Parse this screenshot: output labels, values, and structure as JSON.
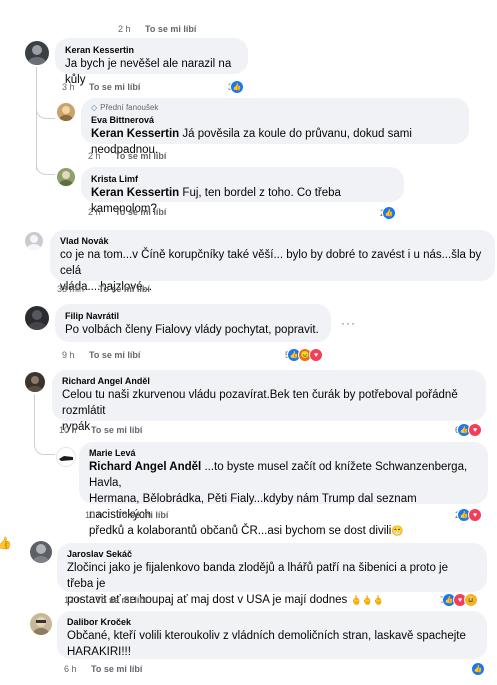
{
  "like_label": "To se mi líbí",
  "top": {
    "time": "2 h"
  },
  "comments": [
    {
      "author": "Keran Kessertin",
      "text": "Ja bych je nevěšel ale narazil na kůly",
      "time": "3 h",
      "reactions": "3",
      "replies": [
        {
          "badge": "Přední fanoušek",
          "author": "Eva Bittnerová",
          "mention": "Keran Kessertin",
          "text": " Já pověsila za koule do průvanu, dokud sami neodpadnou.",
          "time": "2 h"
        },
        {
          "author": "Krista Limf",
          "mention": "Keran Kessertin",
          "text": " Fuj, ten bordel z toho. Co třeba kamenolom?",
          "time": "2 h",
          "reactions": "2"
        }
      ]
    },
    {
      "author": "Vlad Novák",
      "text_lines": [
        "co je na tom...v Číně korupčníky také věší... bylo by dobré to zavést i u nás...šla by celá",
        "vláda....hajzlové..."
      ],
      "time": "33 min"
    },
    {
      "author": "Filip Navrátil",
      "text": "Po volbách členy Fialovy vlády pochytat, popravit.",
      "time": "9 h",
      "reactions": "5",
      "more": "···"
    },
    {
      "author": "Richard Angel Anděl",
      "text_lines": [
        "Celou tu naši zkurvenou vládu pozavírat.Bek ten čurák by potřeboval pořádně rozmlátit",
        "rypák"
      ],
      "time": "10 h",
      "reactions": "6",
      "replies": [
        {
          "author": "Marie Levá",
          "mention": "Richard Angel Anděl",
          "text_lines": [
            " ...to byste musel začít od knížete Schwanzenberga, Havla,",
            "Hermana, Bělobrádka, Pěti Fialy...kdyby nám Trump dal seznam nacistických",
            "předků a kolaborantů občanů ČR...asi bychom se dost divili"
          ],
          "emoji": "😁",
          "time": "10 h",
          "reactions": "2"
        }
      ]
    },
    {
      "author": "Jaroslav Sekáč",
      "text_lines": [
        "Zločinci jako je fijalenkovo banda zlodějů a lhářů patří na šibenici a proto je třeba je",
        "postavit ať se houpaj ať maj dost v USA je mají dodnes "
      ],
      "emoji": "🖕🖕🖕",
      "time": "12 h",
      "reactions": "7"
    },
    {
      "author": "Dalibor Kroček",
      "text_lines": [
        "Občané, kteří volili kteroukoliv z vládních demoličních stran, laskavě spachejte",
        "HARAKIRI!!!"
      ],
      "time": "6 h"
    }
  ]
}
